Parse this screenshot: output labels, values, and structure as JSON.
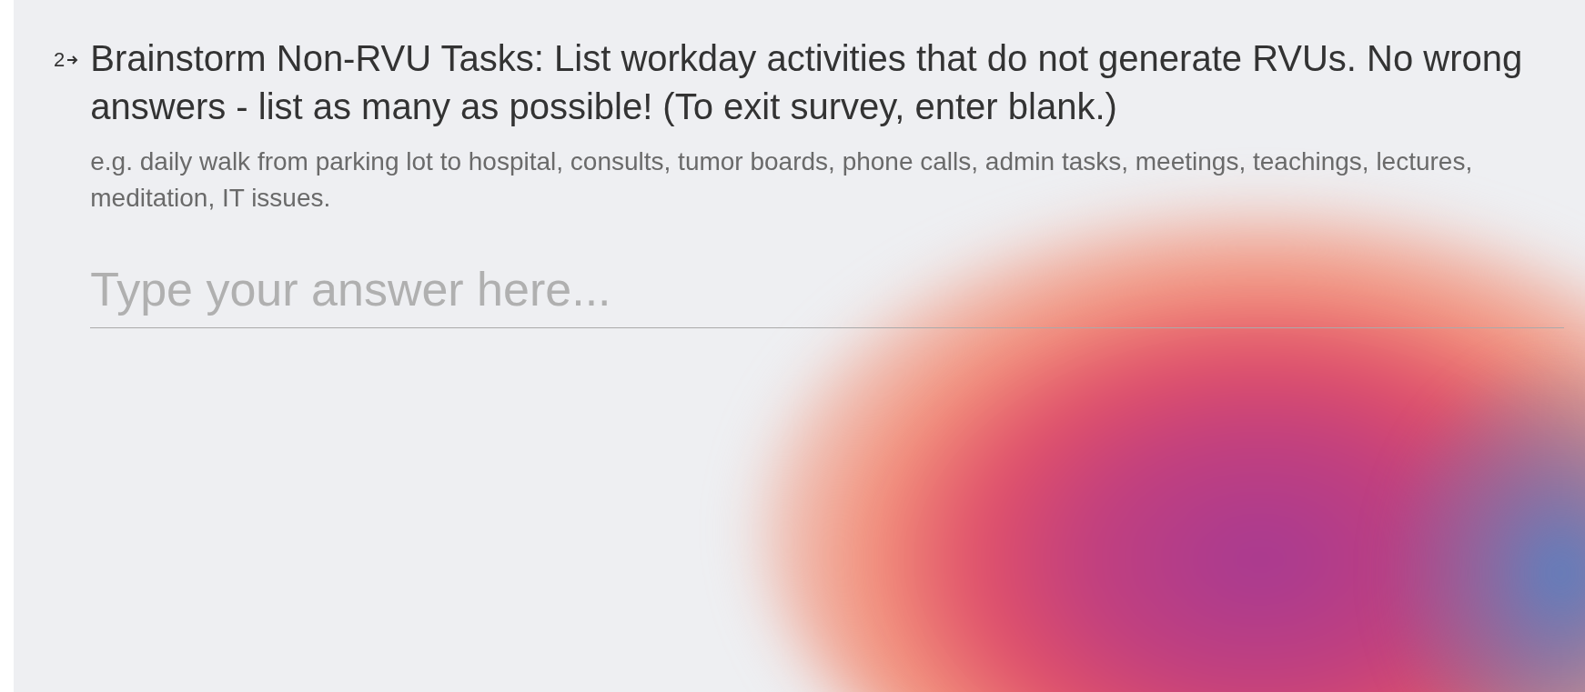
{
  "question": {
    "number": "2",
    "text": "Brainstorm Non-RVU Tasks: List workday activities that do not generate RVUs. No wrong answers - list as many as possible! (To exit survey, enter blank.)",
    "description": "e.g. daily walk from parking lot to hospital, consults, tumor boards, phone calls, admin tasks, meetings, teachings, lectures, meditation, IT issues.",
    "answer": {
      "placeholder": "Type your answer here..."
    }
  }
}
